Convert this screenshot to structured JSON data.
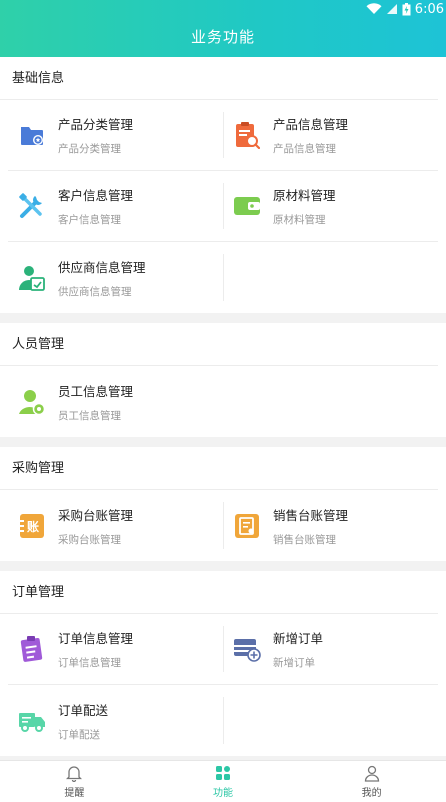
{
  "status_bar": {
    "time": "6:06"
  },
  "header": {
    "title": "业务功能"
  },
  "sections": [
    {
      "title": "基础信息",
      "items": [
        {
          "name": "产品分类管理",
          "sub": "产品分类管理",
          "icon": "folder-star-icon",
          "color": "#4a7bd8"
        },
        {
          "name": "产品信息管理",
          "sub": "产品信息管理",
          "icon": "clipboard-search-icon",
          "color": "#ef6a3c"
        },
        {
          "name": "客户信息管理",
          "sub": "客户信息管理",
          "icon": "tools-icon",
          "color": "#3aaee6"
        },
        {
          "name": "原材料管理",
          "sub": "原材料管理",
          "icon": "wallet-icon",
          "color": "#7ccc4f"
        },
        {
          "name": "供应商信息管理",
          "sub": "供应商信息管理",
          "icon": "supplier-icon",
          "color": "#2bb27a"
        }
      ]
    },
    {
      "title": "人员管理",
      "items": [
        {
          "name": "员工信息管理",
          "sub": "员工信息管理",
          "icon": "user-gear-icon",
          "color": "#8bcf4a"
        }
      ]
    },
    {
      "title": "采购管理",
      "items": [
        {
          "name": "采购台账管理",
          "sub": "采购台账管理",
          "icon": "ledger-icon",
          "color": "#f0a63a",
          "glyph": "账"
        },
        {
          "name": "销售台账管理",
          "sub": "销售台账管理",
          "icon": "sales-ledger-icon",
          "color": "#f0a63a"
        }
      ]
    },
    {
      "title": "订单管理",
      "items": [
        {
          "name": "订单信息管理",
          "sub": "订单信息管理",
          "icon": "order-clipboard-icon",
          "color": "#a05ad8"
        },
        {
          "name": "新增订单",
          "sub": "新增订单",
          "icon": "add-order-icon",
          "color": "#5b6fa8"
        },
        {
          "name": "订单配送",
          "sub": "订单配送",
          "icon": "truck-icon",
          "color": "#58d6a8"
        }
      ]
    }
  ],
  "tabbar": {
    "items": [
      {
        "label": "提醒",
        "icon": "bell-icon"
      },
      {
        "label": "功能",
        "icon": "grid-icon",
        "active": true
      },
      {
        "label": "我的",
        "icon": "person-icon"
      }
    ],
    "active_color": "#2cc7a6"
  }
}
